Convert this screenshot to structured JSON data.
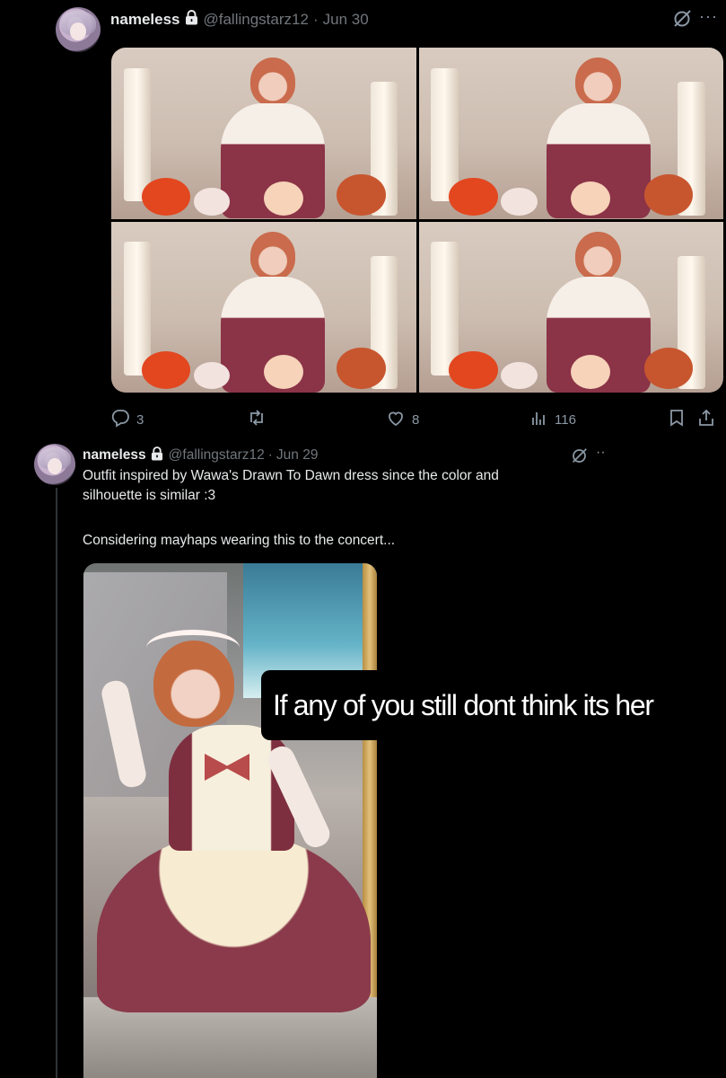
{
  "post1": {
    "display_name": "nameless",
    "handle": "@fallingstarz12",
    "separator": "·",
    "date": "Jun 30",
    "more": "···",
    "actions": {
      "replies": "3",
      "reposts": "",
      "likes": "8",
      "views": "116"
    }
  },
  "post2": {
    "display_name": "nameless",
    "handle": "@fallingstarz12",
    "separator": "·",
    "date": "Jun 29",
    "more": "··",
    "text_line1": "Outfit inspired by Wawa's Drawn To Dawn dress since the color and",
    "text_line2": "silhouette is similar :3",
    "text_line3": "Considering mayhaps wearing this to the concert..."
  },
  "overlay_caption": "If any of you still dont think its her",
  "colors": {
    "background": "#000000",
    "text": "#e7e9ea",
    "muted": "#71767b",
    "icon": "#8b98a5"
  },
  "icons": [
    "lock-icon",
    "grok-icon",
    "more-icon",
    "reply-icon",
    "repost-icon",
    "like-icon",
    "views-icon",
    "bookmark-icon",
    "share-icon"
  ]
}
